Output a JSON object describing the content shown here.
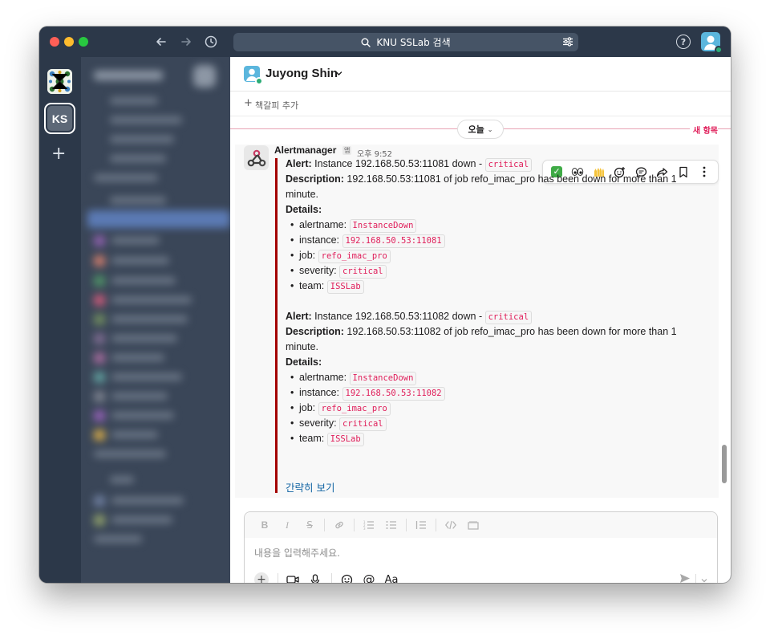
{
  "titlebar": {
    "search_text": "KNU SSLab 검색"
  },
  "rail": {
    "workspace_initials": "KS"
  },
  "channel": {
    "name": "Juyong Shin",
    "add_bookmark": "책갈피 추가"
  },
  "divider": {
    "date_label": "오늘",
    "new_label": "새 항목"
  },
  "message": {
    "sender": "Alertmanager",
    "app_badge": "앱",
    "timestamp": "오후 9:52",
    "show_less": "간략히 보기",
    "alerts": [
      {
        "alert_label": "Alert:",
        "alert_text": "Instance 192.168.50.53:11081 down - ",
        "severity_code": "critical",
        "description_label": "Description:",
        "description_text": "192.168.50.53:11081 of job refo_imac_pro has been down for more than 1 minute.",
        "details_label": "Details:",
        "details": [
          {
            "key": "alertname:",
            "value": "InstanceDown"
          },
          {
            "key": "instance:",
            "value": "192.168.50.53:11081"
          },
          {
            "key": "job:",
            "value": "refo_imac_pro"
          },
          {
            "key": "severity:",
            "value": "critical"
          },
          {
            "key": "team:",
            "value": "ISSLab"
          }
        ]
      },
      {
        "alert_label": "Alert:",
        "alert_text": "Instance 192.168.50.53:11082 down - ",
        "severity_code": "critical",
        "description_label": "Description:",
        "description_text": "192.168.50.53:11082 of job refo_imac_pro has been down for more than 1 minute.",
        "details_label": "Details:",
        "details": [
          {
            "key": "alertname:",
            "value": "InstanceDown"
          },
          {
            "key": "instance:",
            "value": "192.168.50.53:11082"
          },
          {
            "key": "job:",
            "value": "refo_imac_pro"
          },
          {
            "key": "severity:",
            "value": "critical"
          },
          {
            "key": "team:",
            "value": "ISSLab"
          }
        ]
      }
    ]
  },
  "actions": {
    "reactions": [
      "✅",
      "👀",
      "🙌"
    ],
    "icons": [
      "add-reaction-icon",
      "reply-in-thread-icon",
      "forward-icon",
      "save-bookmark-icon",
      "more-actions-icon"
    ]
  },
  "composer": {
    "placeholder": "내용을 입력해주세요.",
    "format_label": "Aa"
  },
  "colors": {
    "attachment_bar": "#a30200",
    "code_text": "#e01e5a",
    "link": "#1264a3",
    "sidebar": "#3a4658"
  }
}
